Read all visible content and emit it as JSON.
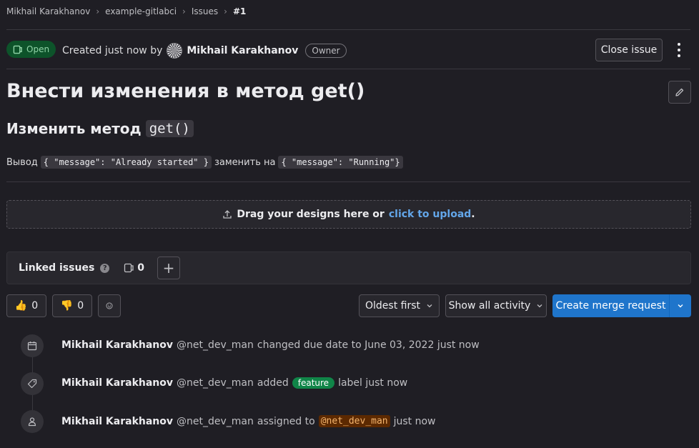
{
  "breadcrumb": {
    "items": [
      "Mikhail Karakhanov",
      "example-gitlabci",
      "Issues",
      "#1"
    ]
  },
  "header": {
    "status": "Open",
    "created_text": "Created just now by",
    "author": "Mikhail Karakhanov",
    "role": "Owner",
    "close_label": "Close issue"
  },
  "issue": {
    "title": "Внести изменения в метод get()",
    "heading_text": "Изменить метод",
    "heading_code": "get()",
    "desc_prefix": "Вывод",
    "desc_code1": "{ \"message\": \"Already started\" }",
    "desc_middle": "заменить на",
    "desc_code2": "{ \"message\": \"Running\"}"
  },
  "designs": {
    "text": "Drag your designs here or",
    "link": "click to upload",
    "suffix": "."
  },
  "linked_issues": {
    "label": "Linked issues",
    "count": "0"
  },
  "reactions": {
    "thumbs_up": "0",
    "thumbs_down": "0"
  },
  "toolbar": {
    "sort_label": "Oldest first",
    "activity_label": "Show all activity",
    "merge_label": "Create merge request"
  },
  "timeline": [
    {
      "author": "Mikhail Karakhanov",
      "handle": "@net_dev_man",
      "action": "changed due date to June 03, 2022 just now"
    },
    {
      "author": "Mikhail Karakhanov",
      "handle": "@net_dev_man",
      "action": "added",
      "label": "feature",
      "after": "label just now"
    },
    {
      "author": "Mikhail Karakhanov",
      "handle": "@net_dev_man",
      "action": "assigned to",
      "mention": "@net_dev_man",
      "after": "just now"
    }
  ],
  "colors": {
    "background": "#1f1e24",
    "accent": "#1f75cb",
    "open_badge": "#0d532a",
    "label_feature": "#108548",
    "link": "#63a6e9"
  }
}
